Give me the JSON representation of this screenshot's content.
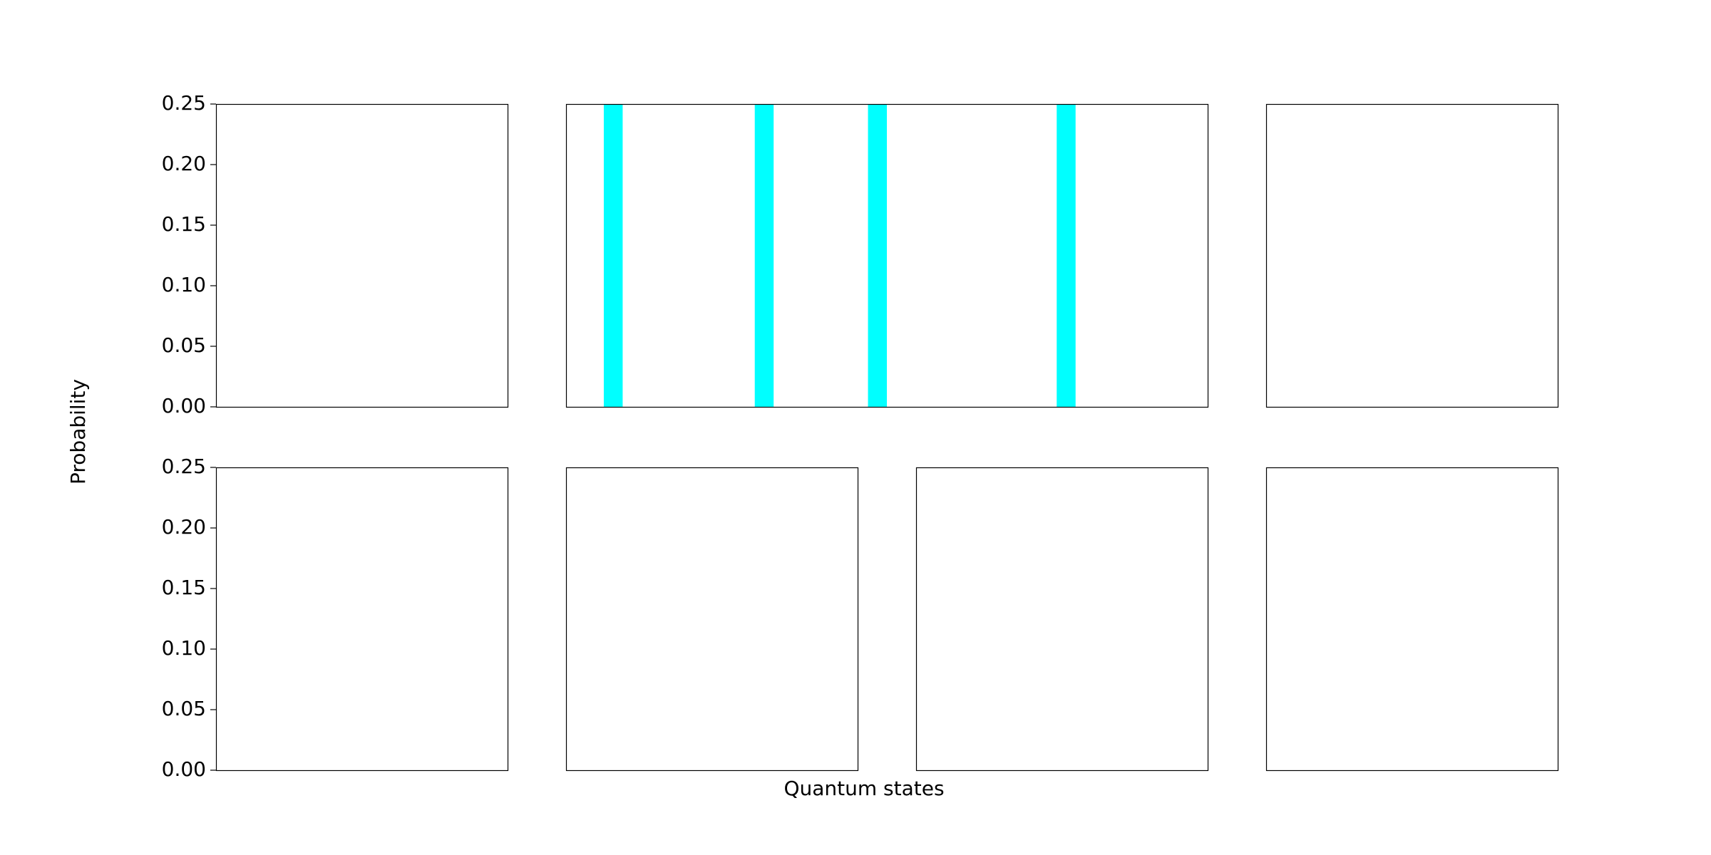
{
  "figure": {
    "ylabel": "Probability",
    "xlabel": "Quantum states"
  },
  "colors": {
    "bar": "#00ffff",
    "axes_edge": "#000000",
    "background": "#ffffff"
  },
  "chart_data": [
    {
      "type": "bar",
      "row": 0,
      "col": 0,
      "ylim": [
        0,
        0.25
      ],
      "yticks": [
        "0.00",
        "0.05",
        "0.10",
        "0.15",
        "0.20",
        "0.25"
      ],
      "show_yticks": true,
      "bars": []
    },
    {
      "type": "bar",
      "row": 0,
      "col": 1,
      "ylim": [
        0,
        0.25
      ],
      "yticks": [],
      "show_yticks": false,
      "xlim": [
        0,
        34
      ],
      "bars": [
        {
          "x": 2,
          "width": 1,
          "value": 0.25
        },
        {
          "x": 10,
          "width": 1,
          "value": 0.25
        },
        {
          "x": 16,
          "width": 1,
          "value": 0.25
        },
        {
          "x": 26,
          "width": 1,
          "value": 0.25
        }
      ]
    },
    {
      "type": "bar",
      "row": 0,
      "col": 3,
      "ylim": [
        0,
        0.25
      ],
      "yticks": [],
      "show_yticks": false,
      "bars": []
    },
    {
      "type": "bar",
      "row": 1,
      "col": 0,
      "ylim": [
        0,
        0.25
      ],
      "yticks": [
        "0.00",
        "0.05",
        "0.10",
        "0.15",
        "0.20",
        "0.25"
      ],
      "show_yticks": true,
      "bars": []
    },
    {
      "type": "bar",
      "row": 1,
      "col": 1,
      "ylim": [
        0,
        0.25
      ],
      "yticks": [],
      "show_yticks": false,
      "bars": []
    },
    {
      "type": "bar",
      "row": 1,
      "col": 2,
      "ylim": [
        0,
        0.25
      ],
      "yticks": [],
      "show_yticks": false,
      "bars": []
    },
    {
      "type": "bar",
      "row": 1,
      "col": 3,
      "ylim": [
        0,
        0.25
      ],
      "yticks": [],
      "show_yticks": false,
      "bars": []
    }
  ]
}
